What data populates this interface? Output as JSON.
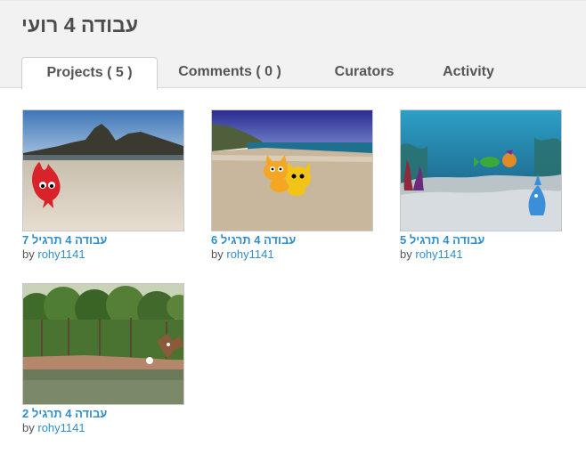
{
  "studio": {
    "title": "עבודה 4 רועי"
  },
  "tabs": [
    {
      "label": "Projects ( 5 )",
      "active": true
    },
    {
      "label": "Comments ( 0 )",
      "active": false
    },
    {
      "label": "Curators",
      "active": false
    },
    {
      "label": "Activity",
      "active": false
    }
  ],
  "projects": [
    {
      "title": "עבודה 4 תרגיל 7",
      "by_label": "by",
      "author": "rohy1141"
    },
    {
      "title": "עבודה 4 תרגיל 6",
      "by_label": "by",
      "author": "rohy1141"
    },
    {
      "title": "עבודה 4 תרגיל 5",
      "by_label": "by",
      "author": "rohy1141"
    },
    {
      "title": "עבודה 4 תרגיל 2",
      "by_label": "by",
      "author": "rohy1141"
    }
  ],
  "colors": {
    "link": "#2f8fce",
    "tab_text": "#555555",
    "header_bg": "#f2f2f2"
  }
}
